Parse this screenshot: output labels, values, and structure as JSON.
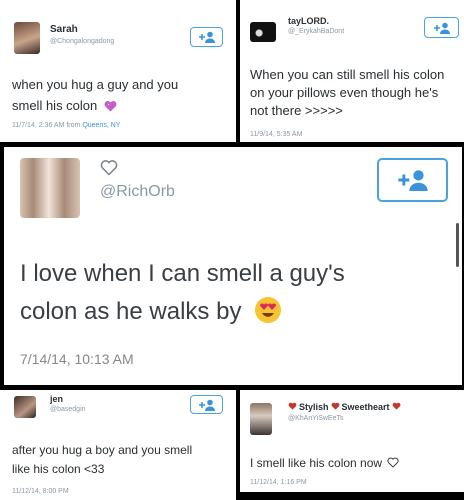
{
  "tweets": [
    {
      "name": "Sarah",
      "handle": "@Chongalongadong",
      "text_line1": "when you hug a guy and you",
      "text_line2": "smell his colon",
      "emoji": "heart",
      "time": "11/7/14, 2:36 AM from",
      "location": "Queens, NY"
    },
    {
      "name": "tayLORD.",
      "handle": "@_ErykahBaDont",
      "text_line1": "When you can still smell his colon",
      "text_line2": "on your pillows even though he's",
      "text_line3": "not there >>>>>",
      "time": "11/9/14, 5:35 AM"
    },
    {
      "name": "",
      "handle": "@RichOrb",
      "text_line1": "I love when I can smell a guy's",
      "text_line2": "colon as he walks by",
      "emoji": "heart-eyes",
      "time": "7/14/14, 10:13 AM"
    },
    {
      "name": "jen",
      "handle": "@basedgin",
      "text_line1": "after you hug a boy and you smell",
      "text_line2": "like his colon <33",
      "time": "11/12/14, 8:00 PM"
    },
    {
      "name": "Stylish",
      "name2": "Sweetheart",
      "handle": "@KhAnYiSwEeTs",
      "text_line1": "I smell like his colon now",
      "time": "11/12/14, 1:16 PM"
    }
  ],
  "colors": {
    "accent": "#3b94d9",
    "text": "#292f33",
    "muted": "#8899a6",
    "background": "#000000"
  },
  "icons": {
    "follow": "add-user-icon",
    "like": "heart-outline-icon"
  }
}
